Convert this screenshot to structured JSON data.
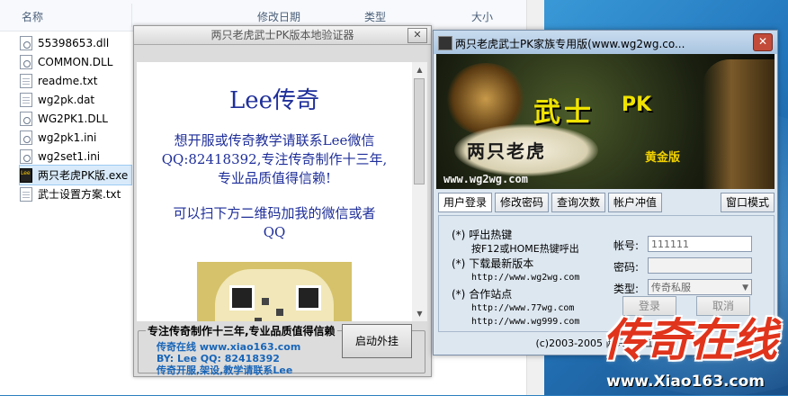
{
  "explorer": {
    "columns": {
      "name": "名称",
      "modified": "修改日期",
      "type": "类型",
      "size": "大小"
    },
    "files": [
      {
        "name": "55398653.dll",
        "icon": "dll-file-icon"
      },
      {
        "name": "COMMON.DLL",
        "icon": "dll-file-icon"
      },
      {
        "name": "readme.txt",
        "icon": "text-file-icon"
      },
      {
        "name": "wg2pk.dat",
        "icon": "text-file-icon"
      },
      {
        "name": "WG2PK1.DLL",
        "icon": "dll-file-icon"
      },
      {
        "name": "wg2pk1.ini",
        "icon": "ini-file-icon"
      },
      {
        "name": "wg2set1.ini",
        "icon": "ini-file-icon"
      },
      {
        "name": "两只老虎PK版.exe",
        "icon": "exe-file-icon",
        "selected": true
      },
      {
        "name": "武士设置方案.txt",
        "icon": "text-file-icon"
      }
    ]
  },
  "verifier": {
    "title": "两只老虎武士PK版本地验证器",
    "close_label": "✕",
    "content": {
      "heading": "Lee传奇",
      "line1": "想开服或传奇教学请联系Lee微信",
      "line2": "QQ:82418392,专注传奇制作十三年,",
      "line3": "专业品质值得信赖!",
      "line4": "可以扫下方二维码加我的微信或者",
      "line5": "QQ"
    },
    "group_title": "专注传奇制作十三年,专业品质值得信赖",
    "info": {
      "line1": "传奇在线 www.xiao163.com",
      "line2": "BY: Lee QQ: 82418392",
      "line3": "传奇开服,架设,教学请联系Lee"
    },
    "start_button": "启动外挂"
  },
  "family": {
    "title": "两只老虎武士PK家族专用版(www.wg2wg.co...",
    "close_label": "✕",
    "banner": {
      "wushi": "武士",
      "pk": "PK",
      "laohu": "两只老虎",
      "edition": "黄金版",
      "url": "www.wg2wg.com"
    },
    "tabs": [
      "用户登录",
      "修改密码",
      "查询次数",
      "帐户冲值",
      "窗口模式"
    ],
    "items": {
      "hotkey_title": "呼出热键",
      "hotkey_desc": "按F12或HOME热键呼出",
      "download_title": "下载最新版本",
      "download_url": "http://www.wg2wg.com",
      "partner_title": "合作站点",
      "partner_url1": "http://www.77wg.com",
      "partner_url2": "http://www.wg999.com",
      "bullet": "(*)"
    },
    "form": {
      "account_label": "帐号:",
      "account_value": "111111",
      "password_label": "密码:",
      "type_label": "类型:",
      "type_value": "传奇私服",
      "login_button": "登录",
      "cancel_button": "取消"
    },
    "footer": "(c)2003-2005 两只老虎工作室"
  },
  "watermark": {
    "text": "传奇在线",
    "url": "www.Xiao163.com"
  },
  "colors": {
    "accent_blue": "#1f2f9a",
    "info_blue": "#1865b8",
    "watermark_red": "#e0341c",
    "banner_yellow": "#f0e300"
  }
}
